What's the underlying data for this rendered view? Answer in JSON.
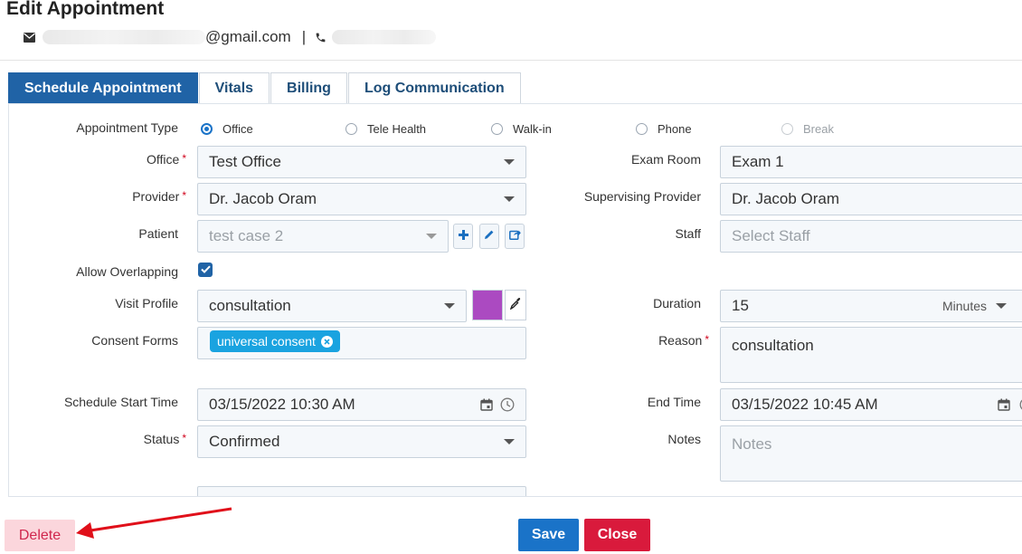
{
  "header": {
    "title": "Edit Appointment",
    "email_suffix": "@gmail.com",
    "separator": "|"
  },
  "tabs": [
    {
      "label": "Schedule Appointment",
      "active": true
    },
    {
      "label": "Vitals",
      "active": false
    },
    {
      "label": "Billing",
      "active": false
    },
    {
      "label": "Log Communication",
      "active": false
    }
  ],
  "form": {
    "appointment_type": {
      "label": "Appointment Type",
      "options": [
        {
          "label": "Office",
          "selected": true,
          "disabled": false
        },
        {
          "label": "Tele Health",
          "selected": false,
          "disabled": false
        },
        {
          "label": "Walk-in",
          "selected": false,
          "disabled": false
        },
        {
          "label": "Phone",
          "selected": false,
          "disabled": false
        },
        {
          "label": "Break",
          "selected": false,
          "disabled": true
        }
      ]
    },
    "office": {
      "label": "Office",
      "value": "Test Office",
      "required": "*"
    },
    "provider": {
      "label": "Provider",
      "value": "Dr. Jacob Oram",
      "required": "*"
    },
    "patient": {
      "label": "Patient",
      "value": "test case 2"
    },
    "allow_overlapping": {
      "label": "Allow Overlapping",
      "checked": true
    },
    "visit_profile": {
      "label": "Visit Profile",
      "value": "consultation",
      "color": "#ab4ac1"
    },
    "consent_forms": {
      "label": "Consent Forms",
      "chips": [
        "universal consent"
      ]
    },
    "schedule_start_time": {
      "label": "Schedule Start Time",
      "value": "03/15/2022 10:30 AM"
    },
    "status": {
      "label": "Status",
      "value": "Confirmed",
      "required": "*"
    },
    "exam_room": {
      "label": "Exam Room",
      "value": "Exam 1"
    },
    "supervising_provider": {
      "label": "Supervising Provider",
      "value": "Dr. Jacob Oram"
    },
    "staff": {
      "label": "Staff",
      "placeholder": "Select Staff"
    },
    "duration": {
      "label": "Duration",
      "value": "15",
      "unit": "Minutes"
    },
    "reason": {
      "label": "Reason",
      "value": "consultation",
      "required": "*"
    },
    "end_time": {
      "label": "End Time",
      "value": "03/15/2022 10:45 AM"
    },
    "notes": {
      "label": "Notes",
      "placeholder": "Notes"
    }
  },
  "footer": {
    "delete_label": "Delete",
    "save_label": "Save",
    "close_label": "Close"
  },
  "colors": {
    "primary": "#2063a6",
    "save": "#1a73c8",
    "close": "#d91a3c",
    "delete_bg": "#fbd6dc",
    "chip": "#1aa3e0",
    "annotation_arrow": "#e0101a"
  },
  "icons": [
    "envelope-icon",
    "phone-icon",
    "plus-icon",
    "pencil-icon",
    "share-icon",
    "check-icon",
    "eyedropper-icon",
    "calendar-icon",
    "clock-icon",
    "close-circle-icon",
    "arrow-annotation"
  ]
}
